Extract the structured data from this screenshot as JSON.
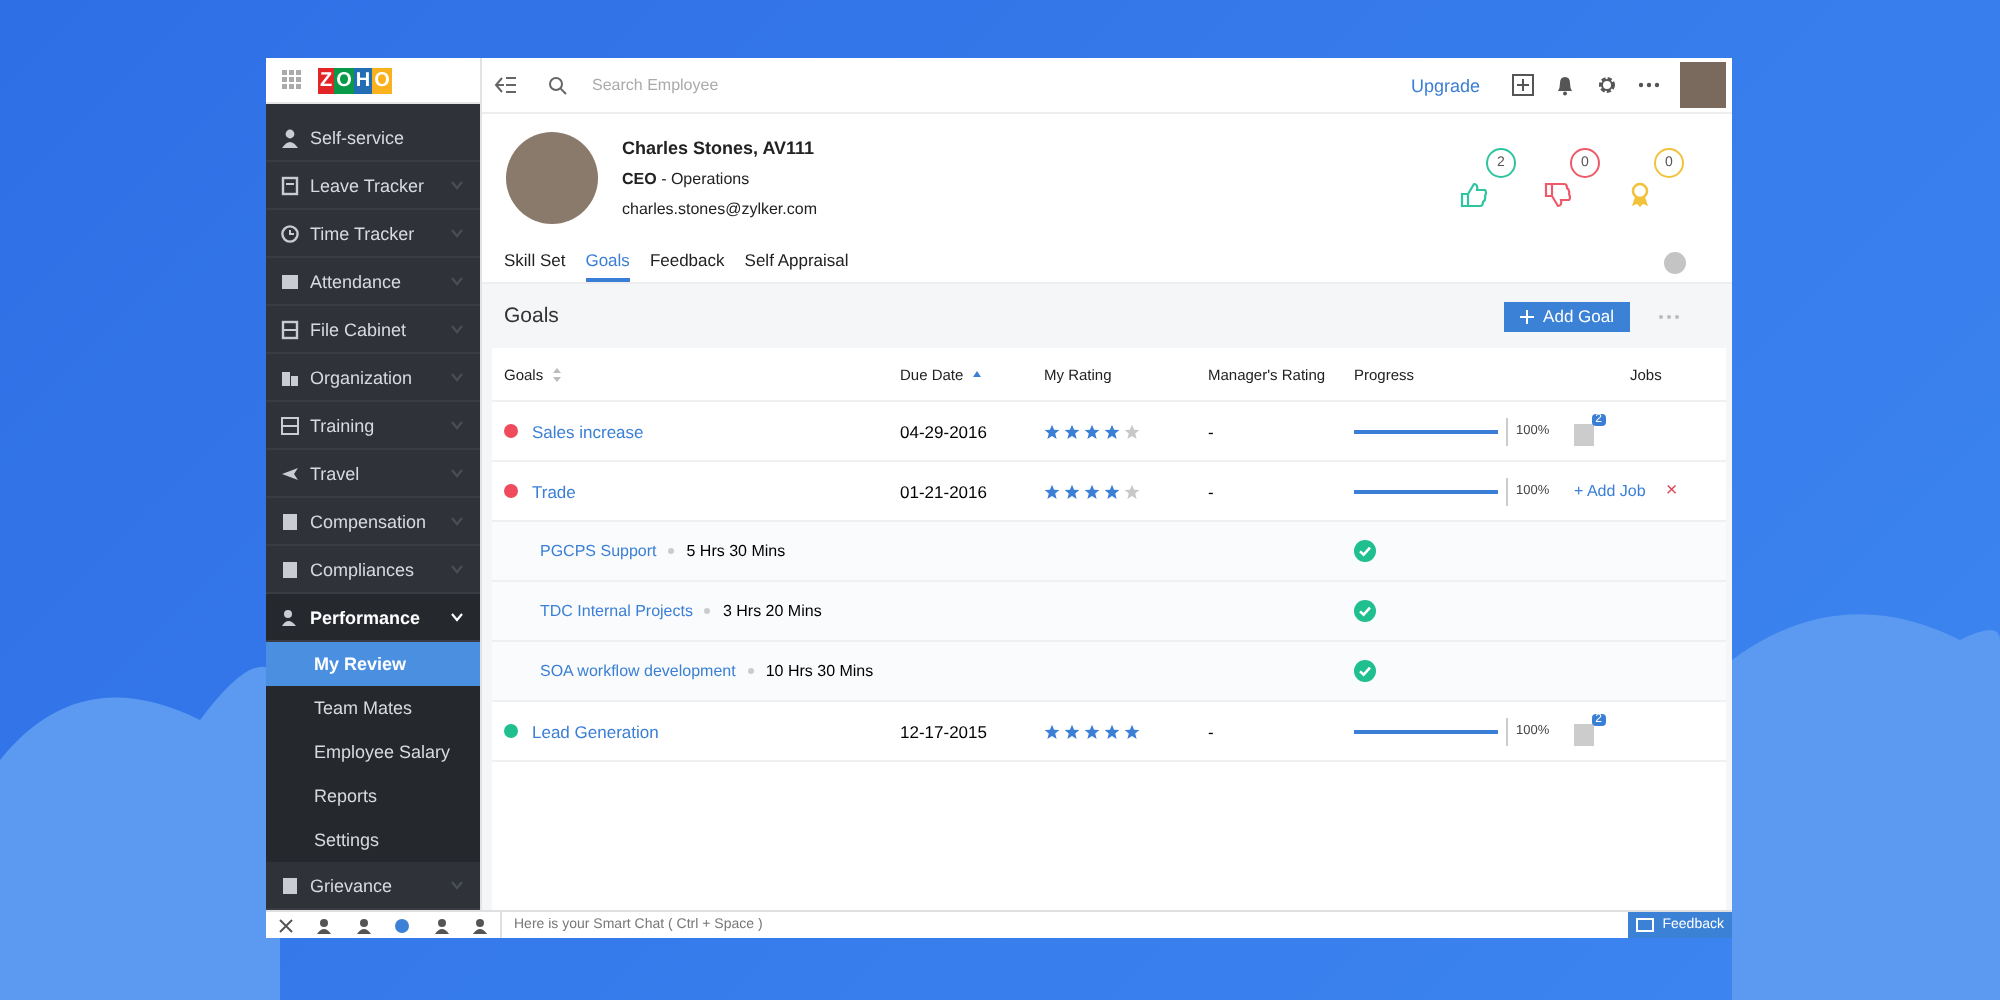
{
  "app_bar": {
    "logo": "ZOHO",
    "search": {
      "placeholder": "Search Employee"
    },
    "upgrade": "Upgrade"
  },
  "sidebar": {
    "items": [
      {
        "label": "Self-service",
        "expandable": false,
        "expanded": false,
        "selected": false
      },
      {
        "label": "Leave Tracker",
        "expandable": true,
        "expanded": false,
        "selected": false
      },
      {
        "label": "Time Tracker",
        "expandable": true,
        "expanded": false,
        "selected": false
      },
      {
        "label": "Attendance",
        "expandable": true,
        "expanded": false,
        "selected": false
      },
      {
        "label": "File Cabinet",
        "expandable": true,
        "expanded": false,
        "selected": false
      },
      {
        "label": "Organization",
        "expandable": true,
        "expanded": false,
        "selected": false
      },
      {
        "label": "Training",
        "expandable": true,
        "expanded": false,
        "selected": false
      },
      {
        "label": "Travel",
        "expandable": true,
        "expanded": false,
        "selected": false
      },
      {
        "label": "Compensation",
        "expandable": true,
        "expanded": false,
        "selected": false
      },
      {
        "label": "Compliances",
        "expandable": true,
        "expanded": false,
        "selected": false
      },
      {
        "label": "Performance",
        "expandable": true,
        "expanded": true,
        "selected": false,
        "children": [
          {
            "label": "My Review",
            "selected": true
          },
          {
            "label": "Team Mates",
            "selected": false
          },
          {
            "label": "Employee Salary",
            "selected": false
          },
          {
            "label": "Reports",
            "selected": false
          },
          {
            "label": "Settings",
            "selected": false
          }
        ]
      },
      {
        "label": "Grievance",
        "expandable": true,
        "expanded": false,
        "selected": false
      }
    ]
  },
  "profile": {
    "name": "Charles Stones, AV111",
    "role": "**CEO** - Operations",
    "email": "charles.stones@zylker.com",
    "badges": [
      {
        "kind": "like",
        "count": "2",
        "color": "#2ec4a0"
      },
      {
        "kind": "dislike",
        "count": "0",
        "color": "#ef5a6a"
      },
      {
        "kind": "award",
        "count": "0",
        "color": "#f2c23a"
      }
    ]
  },
  "tabs": [
    {
      "label": "Skill Set",
      "selected": false
    },
    {
      "label": "Goals",
      "selected": true
    },
    {
      "label": "Feedback",
      "selected": false
    },
    {
      "label": "Self Appraisal",
      "selected": false
    }
  ],
  "goals_panel": {
    "title": "Goals",
    "add_button": "Add Goal"
  },
  "table": {
    "columns": [
      "Goals",
      "Due Date",
      "My Rating",
      "Manager's Rating",
      "Progress",
      "Jobs"
    ],
    "rows": [
      {
        "kind": "goal",
        "name": "Sales increase",
        "color": "#ef4b5d",
        "due_date": "04-29-2016",
        "stars": 4,
        "manager_rating": "-",
        "level": 1,
        "reading": "100%",
        "jobs": "2"
      },
      {
        "kind": "goal",
        "name": "Trade",
        "color": "#ef4b5d",
        "due_date": "01-21-2016",
        "stars": 4,
        "manager_rating": "-",
        "level": 1,
        "reading": "100%",
        "add_job": "+ Add Job",
        "remove": "×"
      },
      {
        "kind": "job",
        "name": "PGCPS Support",
        "duration": "5 Hrs 30 Mins",
        "done": true
      },
      {
        "kind": "job",
        "name": "TDC Internal Projects",
        "duration": "3 Hrs 20 Mins",
        "done": true
      },
      {
        "kind": "job",
        "name": "SOA workflow development",
        "duration": "10 Hrs 30 Mins",
        "done": true
      },
      {
        "kind": "goal",
        "name": "Lead Generation",
        "color": "#1fbf8f",
        "due_date": "12-17-2015",
        "stars": 5,
        "manager_rating": "-",
        "level": 1,
        "reading": "100%",
        "jobs": "2"
      }
    ]
  },
  "chat_bar": {
    "placeholder": "Here is your Smart Chat ( Ctrl + Space )",
    "feedback": "Feedback"
  }
}
